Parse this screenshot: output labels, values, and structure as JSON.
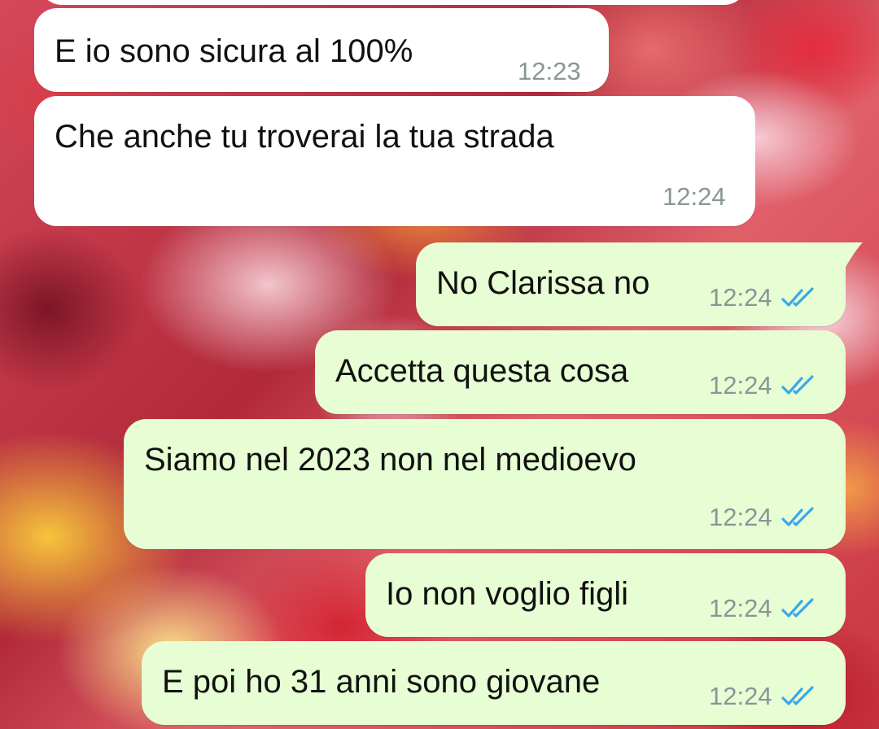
{
  "chat": {
    "messages": [
      {
        "direction": "incoming",
        "text": "E io sono sicura al 100%",
        "time": "12:23"
      },
      {
        "direction": "incoming",
        "text": "Che anche tu troverai la tua strada",
        "time": "12:24"
      },
      {
        "direction": "outgoing",
        "text": "No Clarissa no",
        "time": "12:24",
        "status": "read"
      },
      {
        "direction": "outgoing",
        "text": "Accetta questa cosa",
        "time": "12:24",
        "status": "read"
      },
      {
        "direction": "outgoing",
        "text": "Siamo nel 2023 non nel medioevo",
        "time": "12:24",
        "status": "read"
      },
      {
        "direction": "outgoing",
        "text": "Io non voglio figli",
        "time": "12:24",
        "status": "read"
      },
      {
        "direction": "outgoing",
        "text": "E poi ho 31 anni sono giovane",
        "time": "12:24",
        "status": "read"
      }
    ]
  },
  "colors": {
    "incoming_bubble": "#ffffff",
    "outgoing_bubble": "#e7fdd3",
    "text": "#111111",
    "timestamp": "#8a9597",
    "read_tick": "#3aa8e8"
  },
  "icons": {
    "read_receipt": "double-check-icon"
  }
}
